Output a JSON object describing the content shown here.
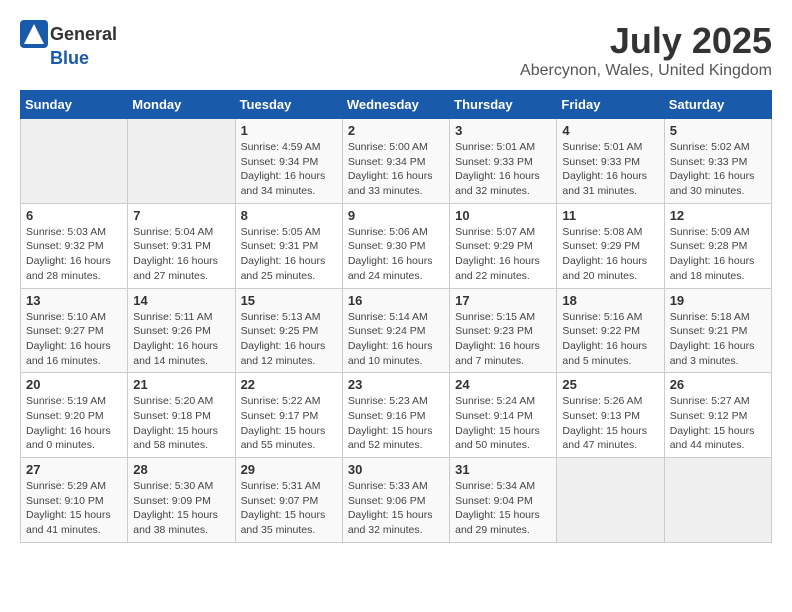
{
  "header": {
    "logo_general": "General",
    "logo_blue": "Blue",
    "month": "July 2025",
    "location": "Abercynon, Wales, United Kingdom"
  },
  "weekdays": [
    "Sunday",
    "Monday",
    "Tuesday",
    "Wednesday",
    "Thursday",
    "Friday",
    "Saturday"
  ],
  "weeks": [
    [
      {
        "day": "",
        "info": ""
      },
      {
        "day": "",
        "info": ""
      },
      {
        "day": "1",
        "info": "Sunrise: 4:59 AM\nSunset: 9:34 PM\nDaylight: 16 hours and 34 minutes."
      },
      {
        "day": "2",
        "info": "Sunrise: 5:00 AM\nSunset: 9:34 PM\nDaylight: 16 hours and 33 minutes."
      },
      {
        "day": "3",
        "info": "Sunrise: 5:01 AM\nSunset: 9:33 PM\nDaylight: 16 hours and 32 minutes."
      },
      {
        "day": "4",
        "info": "Sunrise: 5:01 AM\nSunset: 9:33 PM\nDaylight: 16 hours and 31 minutes."
      },
      {
        "day": "5",
        "info": "Sunrise: 5:02 AM\nSunset: 9:33 PM\nDaylight: 16 hours and 30 minutes."
      }
    ],
    [
      {
        "day": "6",
        "info": "Sunrise: 5:03 AM\nSunset: 9:32 PM\nDaylight: 16 hours and 28 minutes."
      },
      {
        "day": "7",
        "info": "Sunrise: 5:04 AM\nSunset: 9:31 PM\nDaylight: 16 hours and 27 minutes."
      },
      {
        "day": "8",
        "info": "Sunrise: 5:05 AM\nSunset: 9:31 PM\nDaylight: 16 hours and 25 minutes."
      },
      {
        "day": "9",
        "info": "Sunrise: 5:06 AM\nSunset: 9:30 PM\nDaylight: 16 hours and 24 minutes."
      },
      {
        "day": "10",
        "info": "Sunrise: 5:07 AM\nSunset: 9:29 PM\nDaylight: 16 hours and 22 minutes."
      },
      {
        "day": "11",
        "info": "Sunrise: 5:08 AM\nSunset: 9:29 PM\nDaylight: 16 hours and 20 minutes."
      },
      {
        "day": "12",
        "info": "Sunrise: 5:09 AM\nSunset: 9:28 PM\nDaylight: 16 hours and 18 minutes."
      }
    ],
    [
      {
        "day": "13",
        "info": "Sunrise: 5:10 AM\nSunset: 9:27 PM\nDaylight: 16 hours and 16 minutes."
      },
      {
        "day": "14",
        "info": "Sunrise: 5:11 AM\nSunset: 9:26 PM\nDaylight: 16 hours and 14 minutes."
      },
      {
        "day": "15",
        "info": "Sunrise: 5:13 AM\nSunset: 9:25 PM\nDaylight: 16 hours and 12 minutes."
      },
      {
        "day": "16",
        "info": "Sunrise: 5:14 AM\nSunset: 9:24 PM\nDaylight: 16 hours and 10 minutes."
      },
      {
        "day": "17",
        "info": "Sunrise: 5:15 AM\nSunset: 9:23 PM\nDaylight: 16 hours and 7 minutes."
      },
      {
        "day": "18",
        "info": "Sunrise: 5:16 AM\nSunset: 9:22 PM\nDaylight: 16 hours and 5 minutes."
      },
      {
        "day": "19",
        "info": "Sunrise: 5:18 AM\nSunset: 9:21 PM\nDaylight: 16 hours and 3 minutes."
      }
    ],
    [
      {
        "day": "20",
        "info": "Sunrise: 5:19 AM\nSunset: 9:20 PM\nDaylight: 16 hours and 0 minutes."
      },
      {
        "day": "21",
        "info": "Sunrise: 5:20 AM\nSunset: 9:18 PM\nDaylight: 15 hours and 58 minutes."
      },
      {
        "day": "22",
        "info": "Sunrise: 5:22 AM\nSunset: 9:17 PM\nDaylight: 15 hours and 55 minutes."
      },
      {
        "day": "23",
        "info": "Sunrise: 5:23 AM\nSunset: 9:16 PM\nDaylight: 15 hours and 52 minutes."
      },
      {
        "day": "24",
        "info": "Sunrise: 5:24 AM\nSunset: 9:14 PM\nDaylight: 15 hours and 50 minutes."
      },
      {
        "day": "25",
        "info": "Sunrise: 5:26 AM\nSunset: 9:13 PM\nDaylight: 15 hours and 47 minutes."
      },
      {
        "day": "26",
        "info": "Sunrise: 5:27 AM\nSunset: 9:12 PM\nDaylight: 15 hours and 44 minutes."
      }
    ],
    [
      {
        "day": "27",
        "info": "Sunrise: 5:29 AM\nSunset: 9:10 PM\nDaylight: 15 hours and 41 minutes."
      },
      {
        "day": "28",
        "info": "Sunrise: 5:30 AM\nSunset: 9:09 PM\nDaylight: 15 hours and 38 minutes."
      },
      {
        "day": "29",
        "info": "Sunrise: 5:31 AM\nSunset: 9:07 PM\nDaylight: 15 hours and 35 minutes."
      },
      {
        "day": "30",
        "info": "Sunrise: 5:33 AM\nSunset: 9:06 PM\nDaylight: 15 hours and 32 minutes."
      },
      {
        "day": "31",
        "info": "Sunrise: 5:34 AM\nSunset: 9:04 PM\nDaylight: 15 hours and 29 minutes."
      },
      {
        "day": "",
        "info": ""
      },
      {
        "day": "",
        "info": ""
      }
    ]
  ]
}
